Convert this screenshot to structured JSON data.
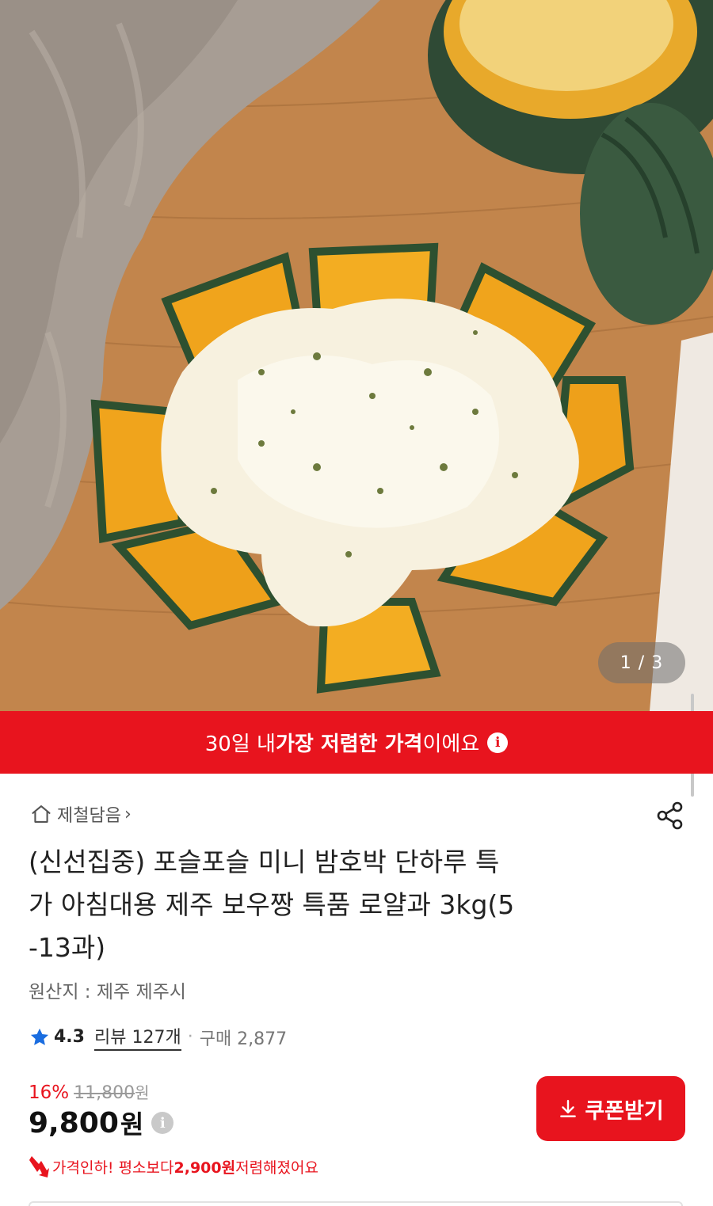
{
  "gallery": {
    "counter": "1 / 3",
    "image_subject": "baked-mini-pumpkin-with-cheese"
  },
  "banner": {
    "prefix": "30일 내 ",
    "highlight": "가장 저렴한 가격",
    "suffix": "이에요",
    "info_icon": "ⓘ",
    "color": "#e8141e"
  },
  "seller": {
    "name": "제철담음",
    "chevron": "›"
  },
  "product": {
    "title_line1": "(신선집중) 포슬포슬 미니 밤호박 단하루 특",
    "title_line2": "가 아침대용 제주 보우짱 특품 로얄과 3kg(5",
    "title_line3": "-13과)",
    "origin": "원산지 : 제주 제주시"
  },
  "rating": {
    "score": "4.3",
    "reviews": "리뷰 127개",
    "separator": "·",
    "purchases": "구매 2,877",
    "star_color": "#1a6de0"
  },
  "pricing": {
    "discount_rate": "16%",
    "original_price": "11,800",
    "original_unit": "원",
    "sale_price": "9,800",
    "sale_unit": "원",
    "info_icon": "i",
    "drop_prefix": "가격인하! 평소보다 ",
    "drop_amount": "2,900원",
    "drop_suffix": " 저렴해졌어요"
  },
  "coupon": {
    "label": "쿠폰받기",
    "icon": "download-icon"
  },
  "icons": {
    "home": "home-icon",
    "share": "share-icon",
    "star": "star-icon",
    "drop": "price-drop-icon"
  }
}
